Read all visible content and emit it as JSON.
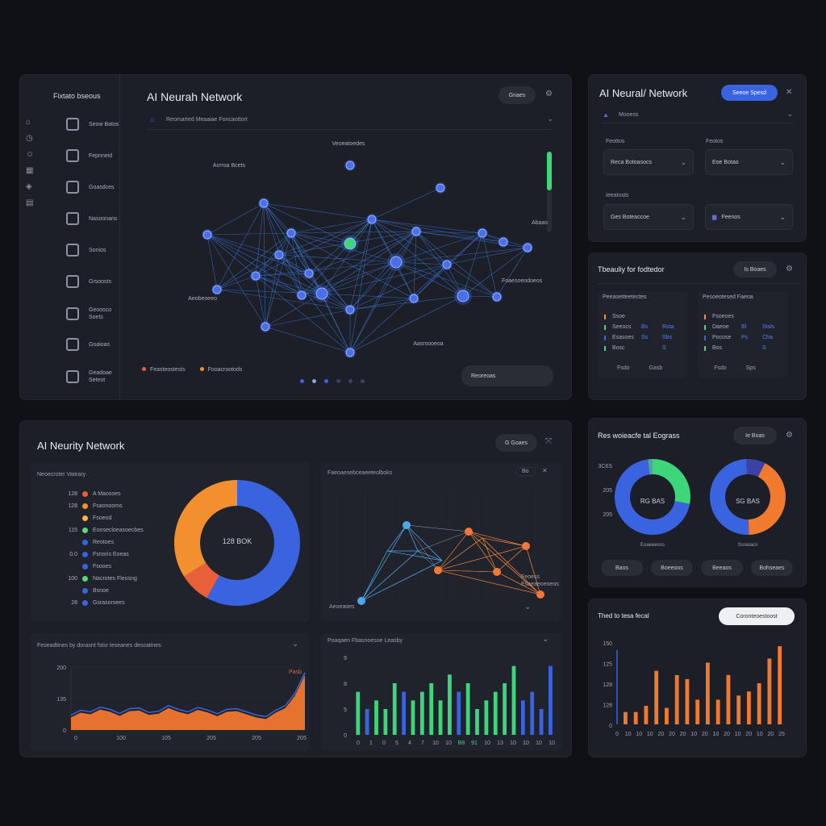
{
  "main_panel": {
    "sidebar_title": "Fixtato bseous",
    "title": "AI Neurah Network",
    "menu_button": "Gnaes",
    "breadcrumb": "Reomarted Meaaiae Foncaottort",
    "nav": [
      {
        "label": "Seow Batos",
        "icon": "bar-icon"
      },
      {
        "label": "Fepnneid",
        "icon": "doc-icon"
      },
      {
        "label": "Goasdces",
        "icon": "layers-icon"
      },
      {
        "label": "Nasoonans",
        "icon": "flask-icon"
      },
      {
        "label": "Sonios",
        "icon": "grid-icon"
      },
      {
        "label": "Grsoosts",
        "icon": "chart-icon"
      },
      {
        "label": "Geoosco Soets",
        "icon": "home-icon"
      },
      {
        "label": "Goaioas",
        "icon": "globe-icon"
      },
      {
        "label": "Geadoae Seteot",
        "icon": "files-icon"
      }
    ],
    "graph_labels": {
      "top": "Veoeatoedes",
      "top_left": "Acrroa Bcets",
      "right": "Abaas",
      "bottom_left": "Aeobeoeeo",
      "bottom_right": "Foaesoeodoeos",
      "bottom": "Aasrsooeoa"
    },
    "legend": [
      "Feasteostests",
      "Fooacrootods"
    ],
    "footer_button": "Reoreoas"
  },
  "config_panel": {
    "title": "AI Neural/ Network",
    "primary_button": "Seeoe Spesd",
    "subtitle": "Mooess",
    "field_labels": [
      "Feottos",
      "Feotos",
      "Ieeatosts"
    ],
    "selects": [
      "Reca Botoasocs",
      "Eoe Botao",
      "Ges Boteaccoe",
      "Feenos"
    ]
  },
  "table_panel": {
    "title": "Tbeauliy for fodtedor",
    "button": "Is Boaes",
    "left_header": "Peeaoetteetectes",
    "right_header": "Pesoeotesed Faeoa",
    "left_rows": [
      [
        "Ssoe",
        "",
        ""
      ],
      [
        "Seeocs",
        "Bs",
        "Rsta"
      ],
      [
        "Esasoes",
        "Ss",
        "Sbs"
      ],
      [
        "Bosc",
        "",
        "S"
      ]
    ],
    "right_rows": [
      [
        "Fsoeoes",
        "",
        ""
      ],
      [
        "Daeoe",
        "Bl",
        "Stsls"
      ],
      [
        "Pocose",
        "Ps",
        "Cha"
      ],
      [
        "Bos",
        "",
        "S"
      ]
    ],
    "left_foot": [
      "Fsdo",
      "Gasb"
    ],
    "right_foot": [
      "Fsdo",
      "Sps"
    ]
  },
  "donut_panel": {
    "title": "AI Neurity Network",
    "button": "G Goaes",
    "legend_title": "Neoecroter Vateary",
    "center": "128 BOK",
    "rows": [
      {
        "value": "128",
        "label": "A Maosoes",
        "color": "#e8603a"
      },
      {
        "value": "128",
        "label": "Fsaonooms",
        "color": "#f2902f"
      },
      {
        "value": "",
        "label": "Fsoeod",
        "color": "#f2b84b"
      },
      {
        "value": "115",
        "label": "Eoosecloeasoecbes",
        "color": "#5ed67c"
      },
      {
        "value": "",
        "label": "Reotoes",
        "color": "#3a63e0"
      },
      {
        "value": "0.0",
        "label": "Fsnoris Eoeas",
        "color": "#3a63e0"
      },
      {
        "value": "",
        "label": "Fsooes",
        "color": "#3a63e0"
      },
      {
        "value": "100",
        "label": "Nacrotes Fleosng",
        "color": "#5ed67c"
      },
      {
        "value": "",
        "label": "Bsnoe",
        "color": "#3a63e0"
      },
      {
        "value": "28",
        "label": "Gsrasorsees",
        "color": "#3a63e0"
      }
    ]
  },
  "mini_graph": {
    "title": "Faeoaesebceaeeteolboks",
    "tag": "Bo",
    "label_right": "Feoess Esaeaeoeoeos",
    "label_bottom": "Aeoeaoes"
  },
  "area_chart": {
    "title": "Feseadtines by dorasnt fstsr teseanes descatines",
    "peak_label": "Pasb"
  },
  "bar_chart_green": {
    "title": "Poaqaen Fbasnoesoe Leasby"
  },
  "pie_panel": {
    "title": "Res woieacfe tal Eograss",
    "button": "Ie Boas",
    "left_center": "RG BAS",
    "right_center": "SG BAS",
    "left_caption": "Eoaeeeoss",
    "right_caption": "Ssrasaco",
    "buttons": [
      "Baos",
      "Boeeoos",
      "Beeaos",
      "Bohseaes"
    ]
  },
  "bar_panel": {
    "title": "Thed to tesa fecal",
    "button": "Coronteoestoost"
  },
  "chart_data": [
    {
      "type": "pie",
      "title": "",
      "labels": [
        "Blue",
        "Orange-red",
        "Orange"
      ],
      "values": [
        58,
        8,
        34
      ],
      "colors": [
        "#3a63e0",
        "#e8603a",
        "#f2902f"
      ]
    },
    {
      "type": "area",
      "title": "",
      "x": [
        "0",
        "1",
        "2",
        "3",
        "4",
        "5",
        "6",
        "7",
        "8",
        "9",
        "10",
        "11",
        "12",
        "13",
        "14",
        "15",
        "16",
        "17",
        "18",
        "19",
        "20",
        "21",
        "22",
        "23",
        "24"
      ],
      "values": [
        40,
        55,
        50,
        65,
        58,
        45,
        60,
        62,
        48,
        52,
        70,
        58,
        50,
        64,
        56,
        44,
        58,
        60,
        50,
        40,
        35,
        55,
        70,
        110,
        175
      ],
      "xticks": [
        "0",
        "100",
        "105",
        "205",
        "205",
        "205"
      ],
      "yticks": [
        "200",
        "135",
        "0"
      ],
      "ylim": [
        0,
        200
      ]
    },
    {
      "type": "bar",
      "title": "",
      "categories": [
        "0",
        "1",
        "2",
        "3",
        "4",
        "5",
        "6",
        "7",
        "8",
        "9",
        "10",
        "11",
        "12",
        "13",
        "14",
        "15",
        "16",
        "17",
        "18",
        "19",
        "20",
        "21"
      ],
      "values": [
        5,
        3,
        4,
        3,
        6,
        5,
        4,
        5,
        6,
        4,
        7,
        5,
        6,
        3,
        4,
        5,
        6,
        8,
        4,
        5,
        3,
        8
      ],
      "colors": [
        "#3ed67a",
        "#3a63e0",
        "#3ed67a",
        "#3ed67a",
        "#3ed67a",
        "#3a63e0",
        "#3ed67a",
        "#3ed67a",
        "#3ed67a",
        "#3ed67a",
        "#3ed67a",
        "#3a63e0",
        "#3ed67a",
        "#3ed67a",
        "#3ed67a",
        "#3ed67a",
        "#3ed67a",
        "#3ed67a",
        "#3a63e0",
        "#3a63e0",
        "#3a63e0",
        "#3a63e0"
      ],
      "xticks": [
        "0",
        "1",
        "0",
        "5",
        "4",
        "7",
        "10",
        "10",
        "B8",
        "91",
        "10",
        "13",
        "10",
        "10",
        "10",
        "10"
      ],
      "ylim": [
        0,
        9
      ]
    },
    {
      "type": "pie",
      "title": "",
      "labels": [
        "Green",
        "Blue",
        "Light"
      ],
      "values": [
        28,
        70,
        2
      ],
      "colors": [
        "#3ed67a",
        "#3a63e0",
        "#4fa3a0"
      ]
    },
    {
      "type": "pie",
      "title": "",
      "labels": [
        "Orange",
        "Blue",
        "Purple"
      ],
      "values": [
        42,
        50,
        8
      ],
      "colors": [
        "#f27a2f",
        "#3a63e0",
        "#3a42a8"
      ]
    },
    {
      "type": "bar",
      "title": "",
      "categories": [
        "0",
        "1",
        "2",
        "3",
        "4",
        "5",
        "6",
        "7",
        "8",
        "9",
        "10",
        "11",
        "12",
        "13",
        "14",
        "15"
      ],
      "values": [
        30,
        30,
        45,
        130,
        40,
        120,
        110,
        60,
        150,
        60,
        120,
        70,
        80,
        100,
        160,
        190
      ],
      "xticks": [
        "0",
        "10",
        "10",
        "10",
        "20",
        "20",
        "20",
        "10",
        "20",
        "10",
        "20",
        "10",
        "20",
        "10",
        "20",
        "25"
      ],
      "yticks": [
        "150",
        "125",
        "128",
        "128",
        "0"
      ],
      "ylim": [
        0,
        200
      ]
    }
  ]
}
